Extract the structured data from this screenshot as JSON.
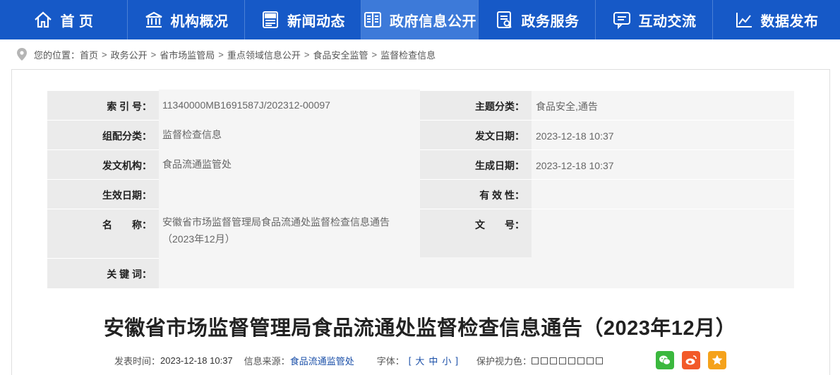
{
  "nav": {
    "items": [
      {
        "label": "首 页",
        "icon": "home-icon"
      },
      {
        "label": "机构概况",
        "icon": "building-icon"
      },
      {
        "label": "新闻动态",
        "icon": "news-icon"
      },
      {
        "label": "政府信息公开",
        "icon": "open-book-icon",
        "active": true
      },
      {
        "label": "政务服务",
        "icon": "service-document-icon"
      },
      {
        "label": "互动交流",
        "icon": "chat-icon"
      },
      {
        "label": "数据发布",
        "icon": "line-chart-icon"
      }
    ]
  },
  "breadcrumb": {
    "prefix": "您的位置：",
    "items": [
      "首页",
      "政务公开",
      "省市场监管局",
      "重点领域信息公开",
      "食品安全监管",
      "监督检查信息"
    ],
    "separator": ">"
  },
  "meta": {
    "index_label": "索 引 号：",
    "index_value": "11340000MB1691587J/202312-00097",
    "topic_label": "主题分类：",
    "topic_value": "食品安全,通告",
    "group_label": "组配分类：",
    "group_value": "监督检查信息",
    "issue_date_label": "发文日期：",
    "issue_date_value": "2023-12-18 10:37",
    "issuer_label": "发文机构：",
    "issuer_value": "食品流通监管处",
    "created_label": "生成日期：",
    "created_value": "2023-12-18 10:37",
    "effective_label": "生效日期：",
    "effective_value": "",
    "validity_label": "有 效 性：",
    "validity_value": "",
    "name_label": "名　　称：",
    "name_value": "安徽省市场监督管理局食品流通处监督检查信息通告（2023年12月）",
    "docno_label": "文　　号：",
    "docno_value": "",
    "keywords_label": "关 键 词：",
    "keywords_value": ""
  },
  "article": {
    "title": "安徽省市场监督管理局食品流通处监督检查信息通告（2023年12月）"
  },
  "info_bar": {
    "time_label": "发表时间：",
    "time_value": "2023-12-18 10:37",
    "source_label": "信息来源：",
    "source_value": "食品流通监管处",
    "font_label": "字体：",
    "font_open": "[",
    "font_large": "大",
    "font_medium": "中",
    "font_small": "小",
    "font_close": "]",
    "vision_label": "保护视力色：",
    "vision_colors": [
      "#ffffff",
      "#ffffff",
      "#ffffff",
      "#ffffff",
      "#ffffff",
      "#ffffff",
      "#ffffff",
      "#ffffff"
    ]
  },
  "share": [
    {
      "icon": "wechat-icon",
      "color": "#3bb83e"
    },
    {
      "icon": "weibo-icon",
      "color": "#f25a29"
    },
    {
      "icon": "favorite-star-icon",
      "color": "#f5a21b"
    }
  ],
  "colors": {
    "nav_bg": "#1659c7",
    "nav_active": "#3d7ad9",
    "link_blue": "#1a4fa8"
  }
}
